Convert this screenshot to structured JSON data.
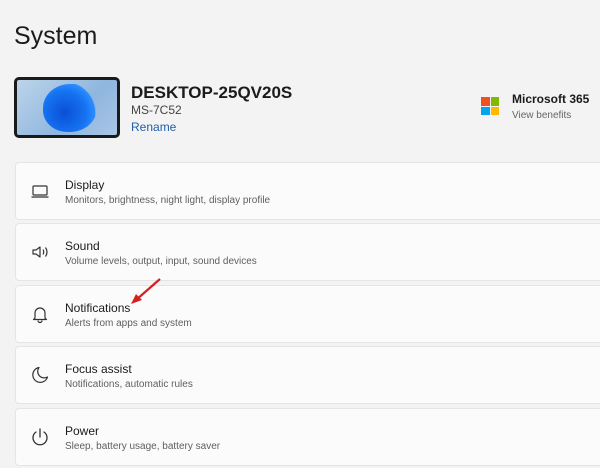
{
  "page": {
    "title": "System"
  },
  "device": {
    "name": "DESKTOP-25QV20S",
    "model": "MS-7C52",
    "rename_label": "Rename"
  },
  "microsoft365": {
    "title": "Microsoft 365",
    "subtitle": "View benefits"
  },
  "items": [
    {
      "label": "Display",
      "description": "Monitors, brightness, night light, display profile",
      "icon": "laptop-icon"
    },
    {
      "label": "Sound",
      "description": "Volume levels, output, input, sound devices",
      "icon": "speaker-icon"
    },
    {
      "label": "Notifications",
      "description": "Alerts from apps and system",
      "icon": "bell-icon"
    },
    {
      "label": "Focus assist",
      "description": "Notifications, automatic rules",
      "icon": "moon-icon"
    },
    {
      "label": "Power",
      "description": "Sleep, battery usage, battery saver",
      "icon": "power-icon"
    }
  ],
  "annotation_color": "#d62020"
}
